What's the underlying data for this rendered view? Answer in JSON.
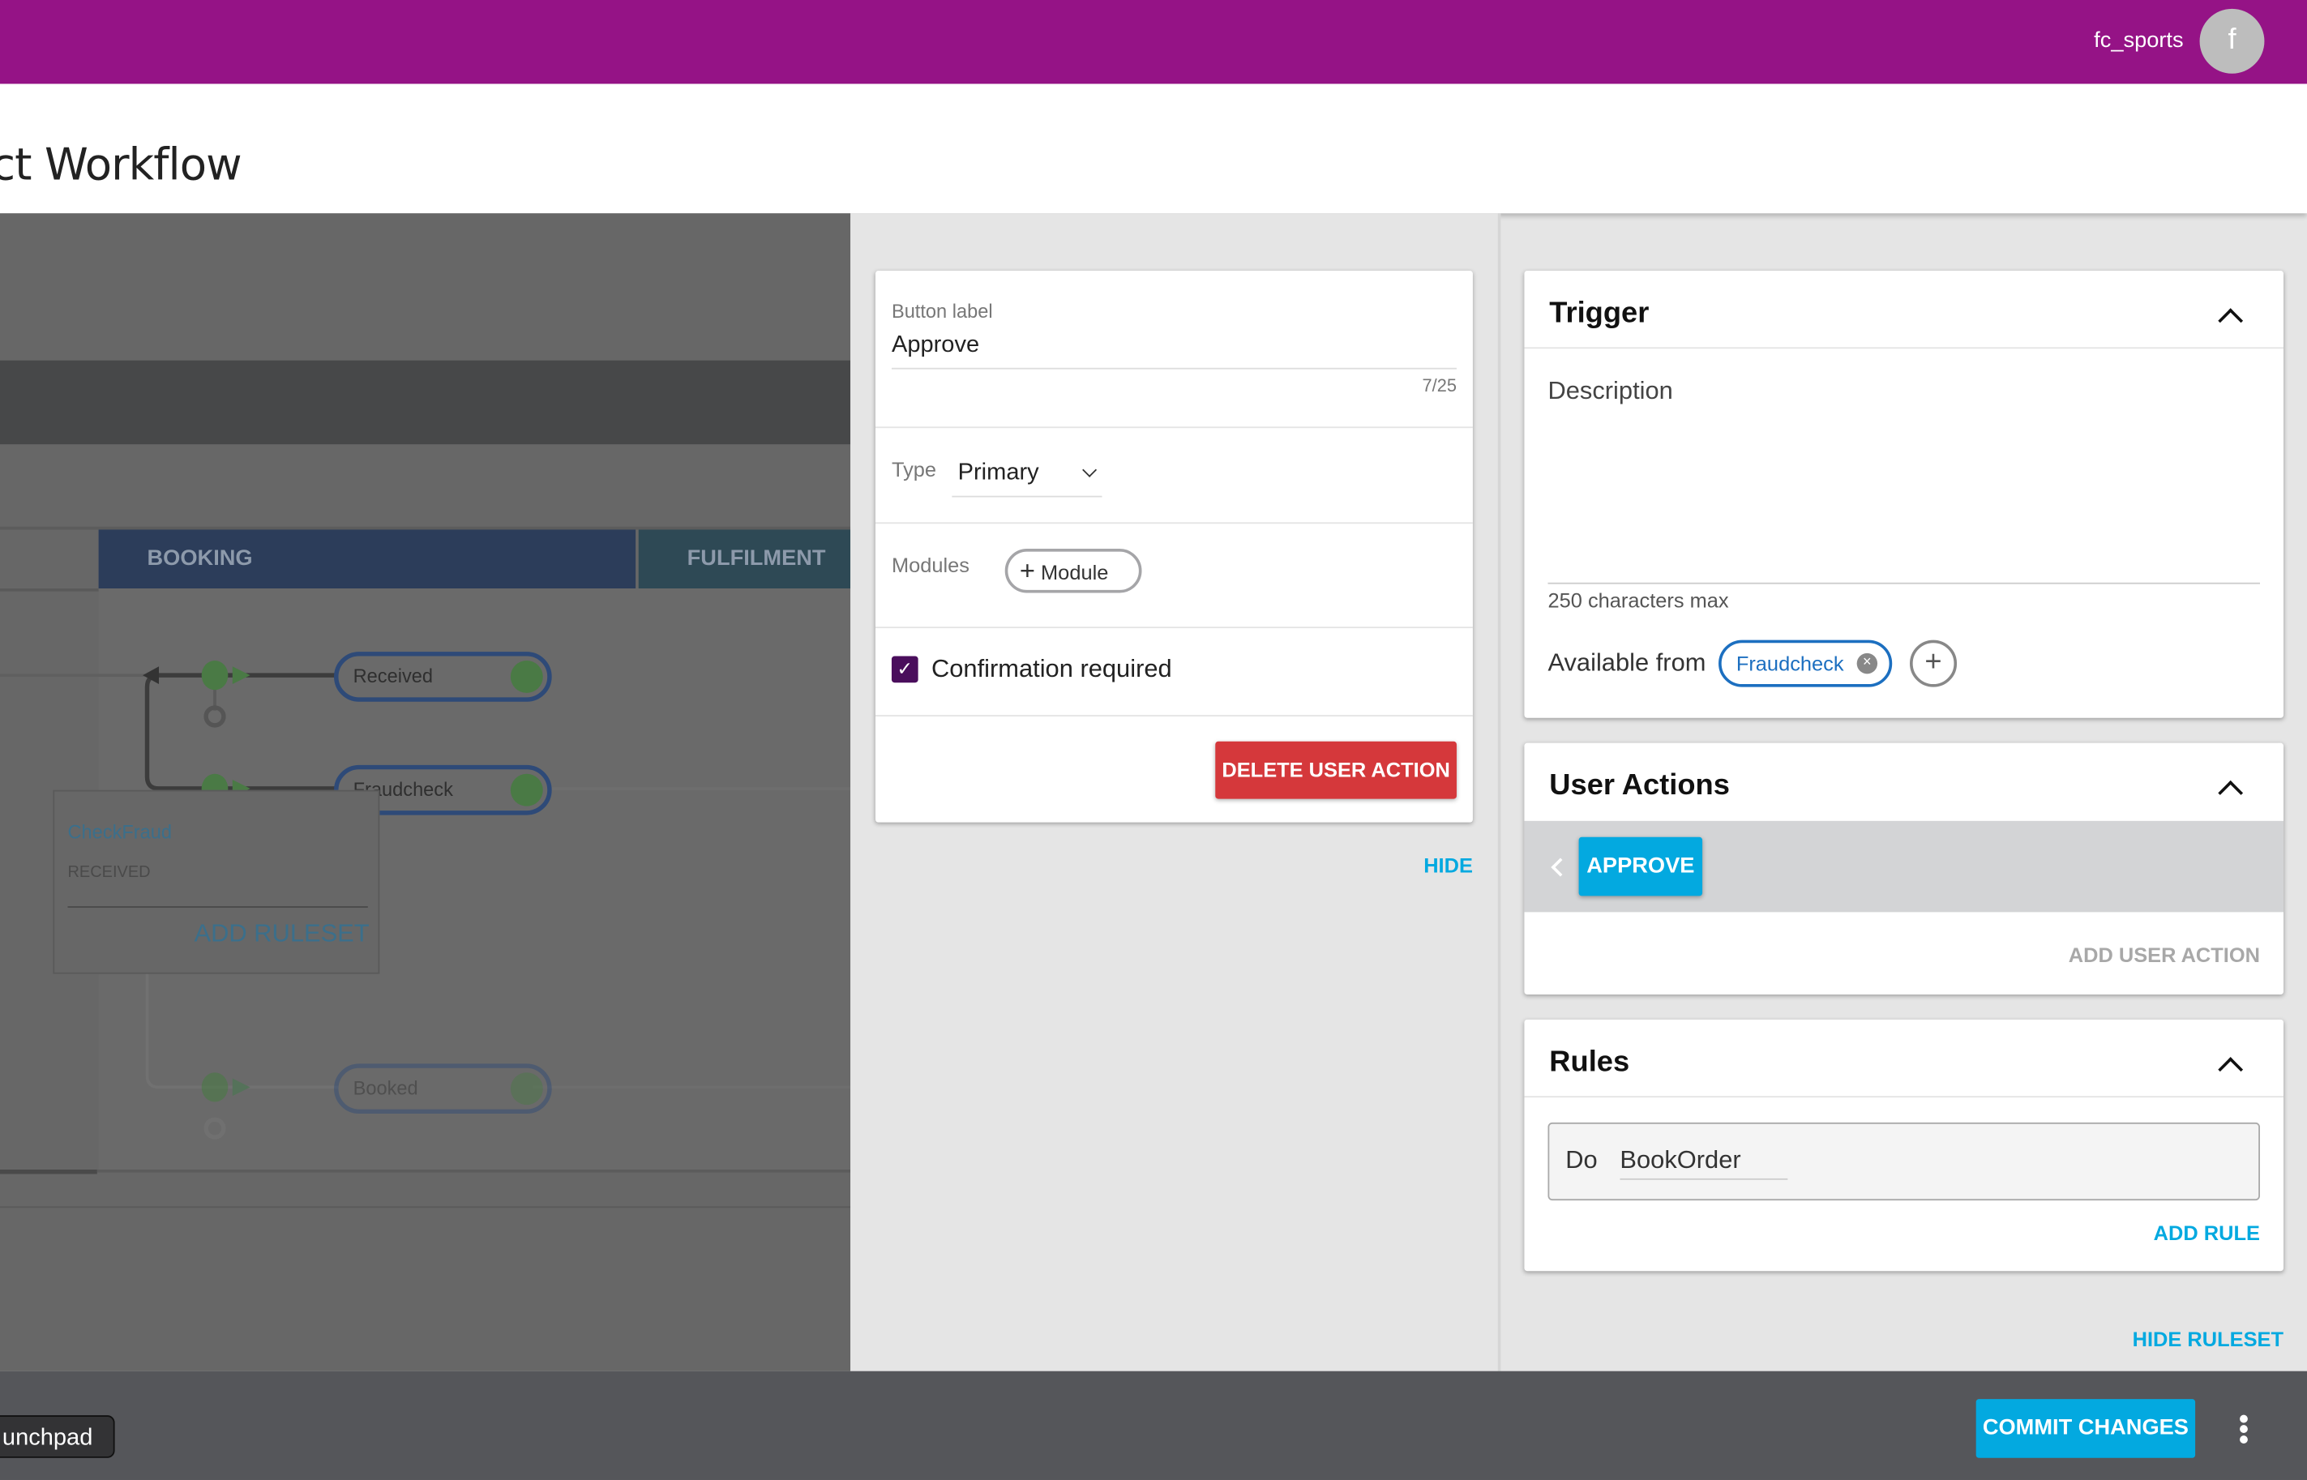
{
  "header": {
    "username": "fc_sports",
    "avatar_letter": "f",
    "brand_color": "#951386"
  },
  "page": {
    "title": "ct Workflow"
  },
  "canvas": {
    "lanes": [
      "BOOKING",
      "FULFILMENT"
    ],
    "nodes": [
      "Received",
      "Fraudcheck",
      "Booked"
    ],
    "ruleset": {
      "name": "CheckFraud",
      "state": "RECEIVED",
      "add_label": "ADD RULESET"
    }
  },
  "user_action_editor": {
    "button_label_caption": "Button label",
    "button_label_value": "Approve",
    "char_count": "7/25",
    "type_caption": "Type",
    "type_value": "Primary",
    "modules_caption": "Modules",
    "add_module": "Module",
    "confirmation_label": "Confirmation required",
    "confirmation_checked": true,
    "delete_label": "DELETE USER ACTION",
    "hide_label": "HIDE"
  },
  "trigger": {
    "title": "Trigger",
    "description_placeholder": "Description",
    "char_hint": "250 characters max",
    "available_from_label": "Available from",
    "available_from_chip": "Fraudcheck"
  },
  "user_actions": {
    "title": "User Actions",
    "actions": [
      "APPROVE"
    ],
    "add_label": "ADD USER ACTION"
  },
  "rules": {
    "title": "Rules",
    "rule_prefix": "Do",
    "rule_value": "BookOrder",
    "add_label": "ADD RULE"
  },
  "hide_ruleset": "HIDE RULESET",
  "footer": {
    "commit_label": "COMMIT CHANGES",
    "tooltip": "unchpad"
  },
  "colors": {
    "accent": "#03a9e0",
    "danger": "#d5383b",
    "checkbox": "#4a0e5c"
  }
}
